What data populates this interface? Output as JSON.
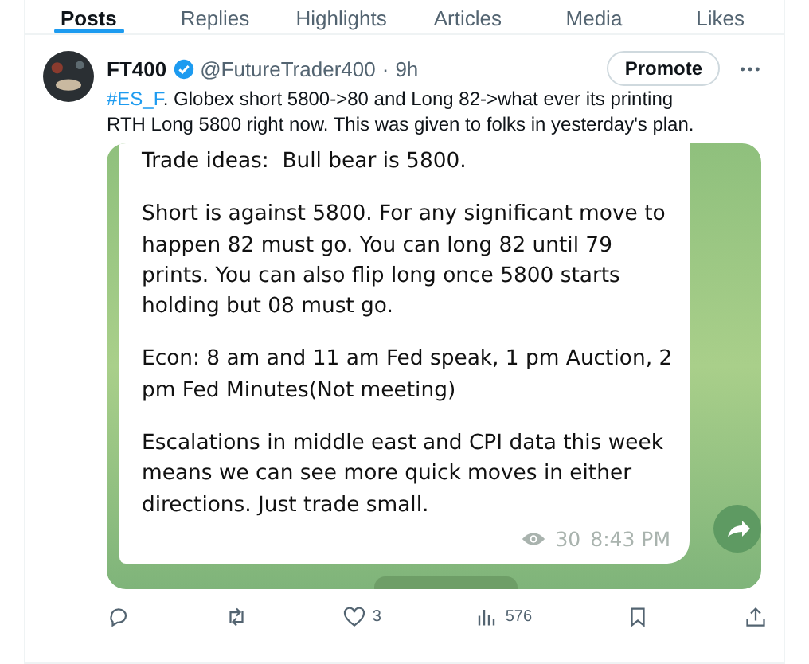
{
  "tabs": [
    {
      "label": "Posts",
      "selected": true
    },
    {
      "label": "Replies",
      "selected": false
    },
    {
      "label": "Highlights",
      "selected": false
    },
    {
      "label": "Articles",
      "selected": false
    },
    {
      "label": "Media",
      "selected": false
    },
    {
      "label": "Likes",
      "selected": false
    }
  ],
  "post": {
    "author": "FT400",
    "verified": true,
    "handle": "@FutureTrader400",
    "separator": "·",
    "time": "9h",
    "promote": "Promote",
    "hashtag": "#ES_F",
    "text": ". Globex short 5800->80 and Long 82->what ever its printing RTH Long 5800 right now. This was given to folks in yesterday's plan.",
    "message": {
      "paragraphs": [
        "Trade ideas:  Bull bear is 5800.",
        "Short is against 5800. For any significant move to happen 82 must go. You can long 82 until 79 prints. You can also flip long once 5800 starts holding but 08 must go.",
        "Econ: 8 am and 11 am Fed speak, 1 pm Auction, 2 pm Fed Minutes(Not meeting)",
        "Escalations in middle east and CPI data this week means we can see more quick moves in either directions. Just trade small."
      ],
      "views": "30",
      "time": "8:43 PM"
    },
    "actions": [
      {
        "kind": "reply"
      },
      {
        "kind": "repost"
      },
      {
        "kind": "like",
        "count": "3"
      },
      {
        "kind": "views",
        "count": "576"
      },
      {
        "kind": "bookmark"
      },
      {
        "kind": "share"
      }
    ]
  }
}
